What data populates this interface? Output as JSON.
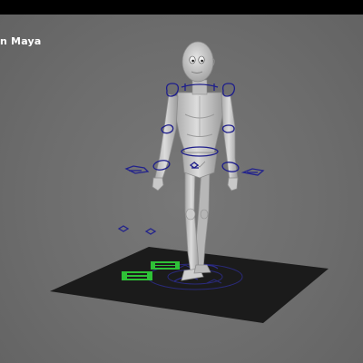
{
  "viewport": {
    "label": "n Maya"
  },
  "scene": {
    "character": "biped-rig-mannequin",
    "pose": "walk-cycle",
    "colors": {
      "background": "#6c6c6c",
      "top_bar": "#000000",
      "ground_plane": "#1b1b1b",
      "rig_controls": "#1e1e8c",
      "selected_controls": "#31d43a",
      "skin": "#d4d4d4",
      "skin_shadow": "#9c9c9c"
    }
  }
}
